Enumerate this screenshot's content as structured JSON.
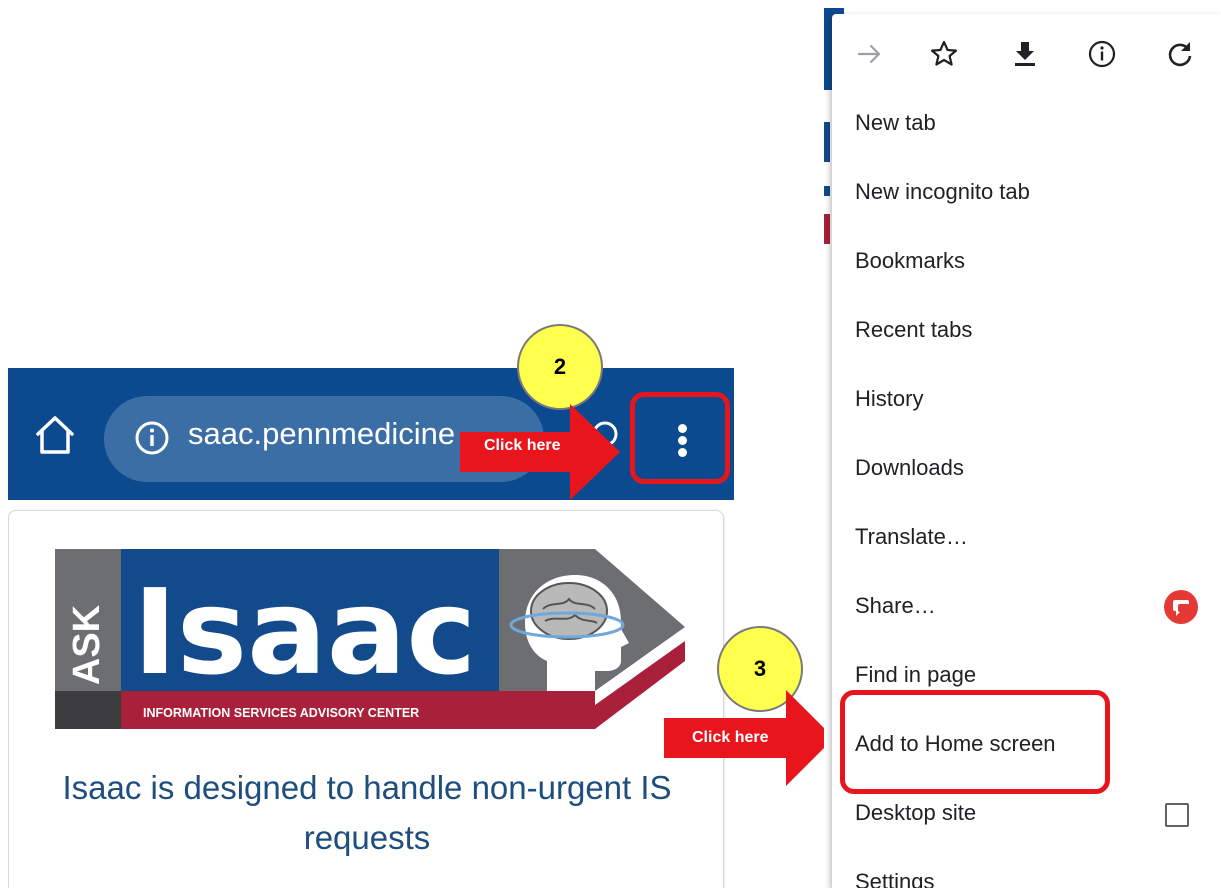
{
  "browser_bar": {
    "url_text": "saac.pennmedicine",
    "home_icon": "home-icon",
    "info_icon": "info-icon",
    "menu_icon": "more-vert-icon",
    "bar_color": "#0b4a8e",
    "url_pill_color": "#3b6ea5"
  },
  "page": {
    "logo": {
      "ask": "ASK",
      "name": "Isaac",
      "tagline": "INFORMATION SERVICES ADVISORY CENTER"
    },
    "description": "Isaac is designed to handle non-urgent IS requests"
  },
  "callouts": [
    {
      "step": "2",
      "label": "Click here"
    },
    {
      "step": "3",
      "label": "Click here"
    }
  ],
  "menu": {
    "icons": [
      "forward-arrow-icon",
      "star-bookmark-icon",
      "download-icon",
      "info-icon",
      "refresh-icon"
    ],
    "items": [
      {
        "label": "New tab"
      },
      {
        "label": "New incognito tab"
      },
      {
        "label": "Bookmarks"
      },
      {
        "label": "Recent tabs"
      },
      {
        "label": "History"
      },
      {
        "label": "Downloads"
      },
      {
        "label": "Translate…"
      },
      {
        "label": "Share…",
        "icon": "share-chat-icon"
      },
      {
        "label": "Find in page"
      },
      {
        "label": "Add to Home screen"
      },
      {
        "label": "Desktop site",
        "checked": false
      },
      {
        "label": "Settings"
      }
    ]
  },
  "colors": {
    "accent_red": "#e8161c",
    "badge_yellow": "#ffff4d",
    "logo_blue": "#124a8c",
    "logo_gray": "#6d6e71",
    "logo_crimson": "#a8203a"
  }
}
